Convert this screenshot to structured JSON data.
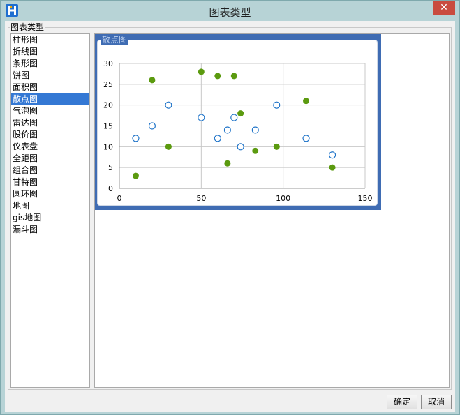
{
  "window": {
    "title": "图表类型"
  },
  "group": {
    "label": "图表类型"
  },
  "chart_types": [
    "柱形图",
    "折线图",
    "条形图",
    "饼图",
    "面积图",
    "散点图",
    "气泡图",
    "雷达图",
    "股价图",
    "仪表盘",
    "全距图",
    "组合图",
    "甘特图",
    "圆环图",
    "地图",
    "gis地图",
    "漏斗图"
  ],
  "selected_type": "散点图",
  "preview": {
    "label": "散点图"
  },
  "colors": {
    "series_hollow": "#1e73c8",
    "series_solid": "#5b9a0f",
    "frame": "#3f6cb3",
    "selected": "#3478d4"
  },
  "buttons": {
    "ok": "确定",
    "cancel": "取消"
  },
  "chart_data": {
    "type": "scatter",
    "xlim": [
      0,
      150
    ],
    "ylim": [
      0,
      30
    ],
    "xticks": [
      0,
      50,
      100,
      150
    ],
    "yticks": [
      0,
      5,
      10,
      15,
      20,
      25,
      30
    ],
    "grid": true,
    "legend": "none",
    "series": [
      {
        "marker": "hollow-circle",
        "color": "#1e73c8",
        "points": [
          [
            10,
            12
          ],
          [
            20,
            15
          ],
          [
            30,
            20
          ],
          [
            50,
            17
          ],
          [
            60,
            12
          ],
          [
            66,
            14
          ],
          [
            70,
            17
          ],
          [
            74,
            10
          ],
          [
            83,
            14
          ],
          [
            96,
            20
          ],
          [
            114,
            12
          ],
          [
            130,
            8
          ]
        ]
      },
      {
        "marker": "filled-circle",
        "color": "#5b9a0f",
        "points": [
          [
            10,
            3
          ],
          [
            20,
            26
          ],
          [
            30,
            10
          ],
          [
            50,
            28
          ],
          [
            60,
            27
          ],
          [
            66,
            6
          ],
          [
            70,
            27
          ],
          [
            74,
            18
          ],
          [
            83,
            9
          ],
          [
            96,
            10
          ],
          [
            114,
            21
          ],
          [
            130,
            5
          ]
        ]
      }
    ]
  }
}
